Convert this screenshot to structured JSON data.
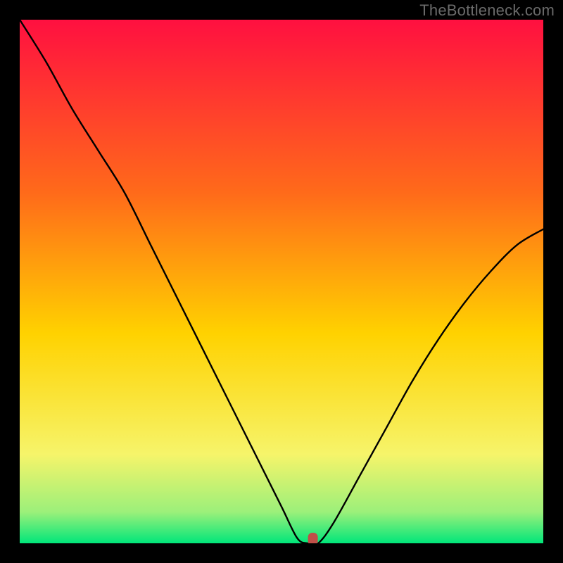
{
  "watermark": "TheBottleneck.com",
  "chart_data": {
    "type": "line",
    "title": "",
    "xlabel": "",
    "ylabel": "",
    "xlim": [
      0,
      100
    ],
    "ylim": [
      0,
      100
    ],
    "grid": false,
    "legend": false,
    "series": [
      {
        "name": "curve",
        "x": [
          0,
          5,
          10,
          15,
          20,
          25,
          30,
          35,
          40,
          45,
          50,
          53,
          55,
          57,
          60,
          65,
          70,
          75,
          80,
          85,
          90,
          95,
          100
        ],
        "y": [
          100,
          92,
          83,
          75,
          67,
          57,
          47,
          37,
          27,
          17,
          7,
          1,
          0,
          0,
          4,
          13,
          22,
          31,
          39,
          46,
          52,
          57,
          60
        ]
      }
    ],
    "marker": {
      "x": 56,
      "y": 0.8
    },
    "gradient_colors": {
      "top": "#FF1040",
      "mid1": "#FF6A1A",
      "mid2": "#FFD200",
      "mid3": "#F6F46A",
      "low": "#9CF07A",
      "bottom": "#00E67A"
    },
    "marker_color": "#C05048",
    "curve_color": "#000000"
  }
}
